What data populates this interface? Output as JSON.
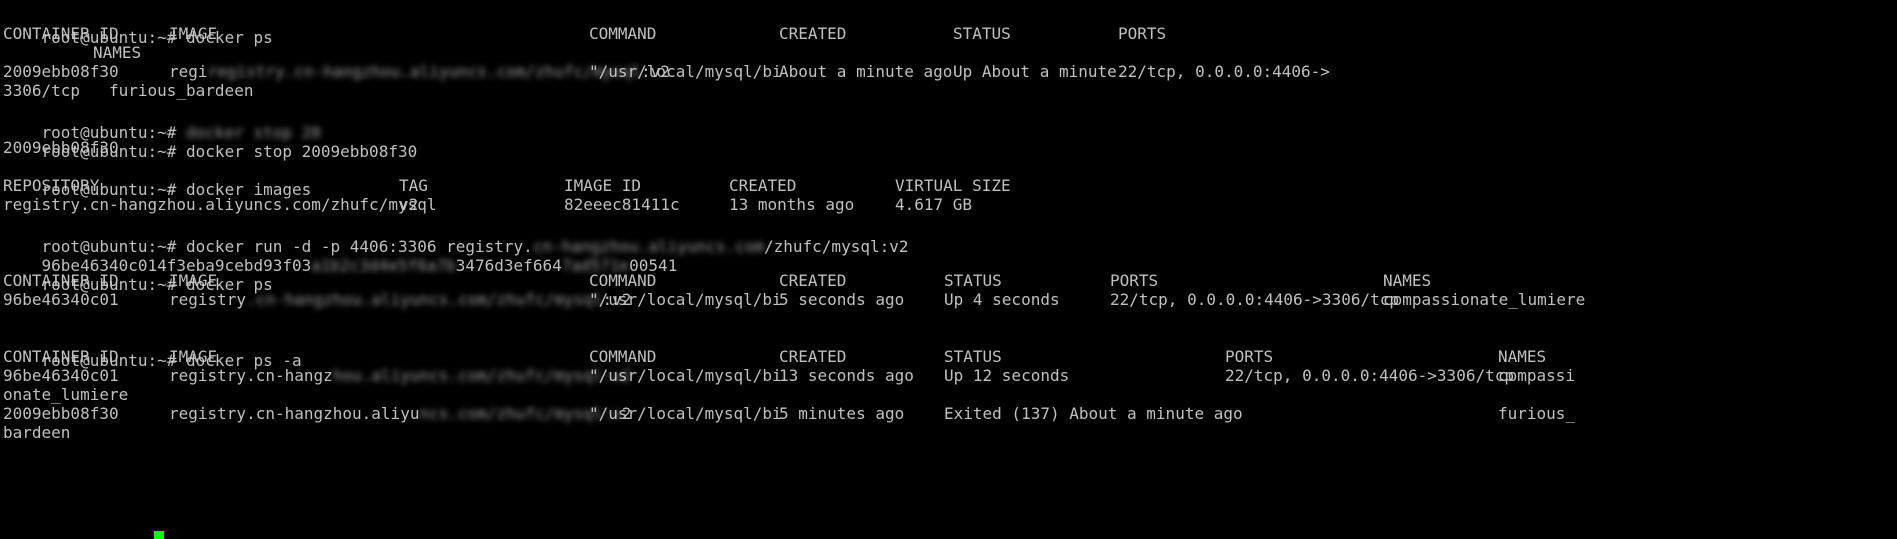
{
  "terminal": {
    "prompt": "root@ubuntu:~#",
    "lines": [
      {
        "kind": "cmd",
        "text": "docker ps"
      },
      {
        "kind": "row",
        "cells": [
          "CONTAINER ID",
          "IMAGE",
          "COMMAND",
          "CREATED",
          "STATUS",
          "PORTS"
        ]
      },
      {
        "kind": "row",
        "cells": [
          "NAMES"
        ]
      },
      {
        "kind": "row",
        "cells": [
          "2009ebb08f30",
          "regi",
          "registry.cn-hangzhou.aliyuncs.com/zhufc/mysql",
          ":v2",
          "\"/usr/local/mysql/bi",
          "About a minute ago",
          "Up About a minute",
          "22/tcp, 0.0.0.0:4406->"
        ]
      },
      {
        "kind": "text",
        "text": "3306/tcp   furious_bardeen"
      },
      {
        "kind": "cmd-blur",
        "text": "",
        "blur": "docker stop 20"
      },
      {
        "kind": "cmd",
        "text": "docker stop 2009ebb08f30"
      },
      {
        "kind": "text",
        "text": "2009ebb08f30"
      },
      {
        "kind": "cmd",
        "text": "docker images"
      },
      {
        "kind": "row",
        "cells": [
          "REPOSITORY",
          "TAG",
          "IMAGE ID",
          "CREATED",
          "VIRTUAL SIZE"
        ]
      },
      {
        "kind": "row",
        "cells": [
          "registry.cn-hangzhou.aliyuncs.com/zhufc/mysql",
          "v2",
          "82eeec81411c",
          "13 months ago",
          "4.617 GB"
        ]
      },
      {
        "kind": "cmd-mixed",
        "before": "docker run -d -p 4406:3306 registry.",
        "blur": "cn-hangzhou.aliyuncs.com",
        "after": "/zhufc/mysql:v2"
      },
      {
        "kind": "text-mixed",
        "before": "96be46340c014f3eba9cebd93f03",
        "blur": "a1b2c3d4e5f6a7b",
        "after": "3476d3ef664",
        "blur2": "7ad571e",
        "after2": "00541"
      },
      {
        "kind": "cmd",
        "text": "docker ps"
      },
      {
        "kind": "row",
        "cells": [
          "CONTAINER ID",
          "IMAGE",
          "COMMAND",
          "CREATED",
          "STATUS",
          "PORTS",
          "NAMES"
        ]
      },
      {
        "kind": "row",
        "cells": [
          "96be46340c01",
          "registry",
          ".cn-hangzhou.aliyuncs.com/zhufc/mysql",
          ":v2",
          "\"/usr/local/mysql/bi",
          "5 seconds ago",
          "Up 4 seconds",
          "22/tcp, 0.0.0.0:4406->3306/tcp",
          "compassionate_lumiere"
        ]
      },
      {
        "kind": "blank",
        "text": ""
      },
      {
        "kind": "cmd",
        "text": "docker ps -a"
      },
      {
        "kind": "row",
        "cells": [
          "CONTAINER ID",
          "IMAGE",
          "COMMAND",
          "CREATED",
          "STATUS",
          "PORTS",
          "NAMES"
        ]
      },
      {
        "kind": "row",
        "cells": [
          "96be46340c01",
          "registry.cn-hangz",
          "hou.aliyuncs.com/zhufc/mysql:v2",
          "\"/usr/local/mysql/bi",
          "13 seconds ago",
          "Up 12 seconds",
          "22/tcp, 0.0.0.0:4406->3306/tcp",
          "compassi"
        ]
      },
      {
        "kind": "text",
        "text": "onate_lumiere"
      },
      {
        "kind": "row",
        "cells": [
          "2009ebb08f30",
          "registry.cn-hangzhou.aliyu",
          "ncs.com/zhufc/mysql:v",
          "2",
          "\"/usr/local/mysql/bi",
          "5 minutes ago",
          "Exited (137) About a minute ago",
          "furious_"
        ]
      },
      {
        "kind": "text",
        "text": "bardeen"
      },
      {
        "kind": "prompt-only",
        "text": ""
      }
    ]
  },
  "colors": {
    "background": "#000000",
    "text": "#c0c0c0",
    "cursor": "#00ff00"
  }
}
